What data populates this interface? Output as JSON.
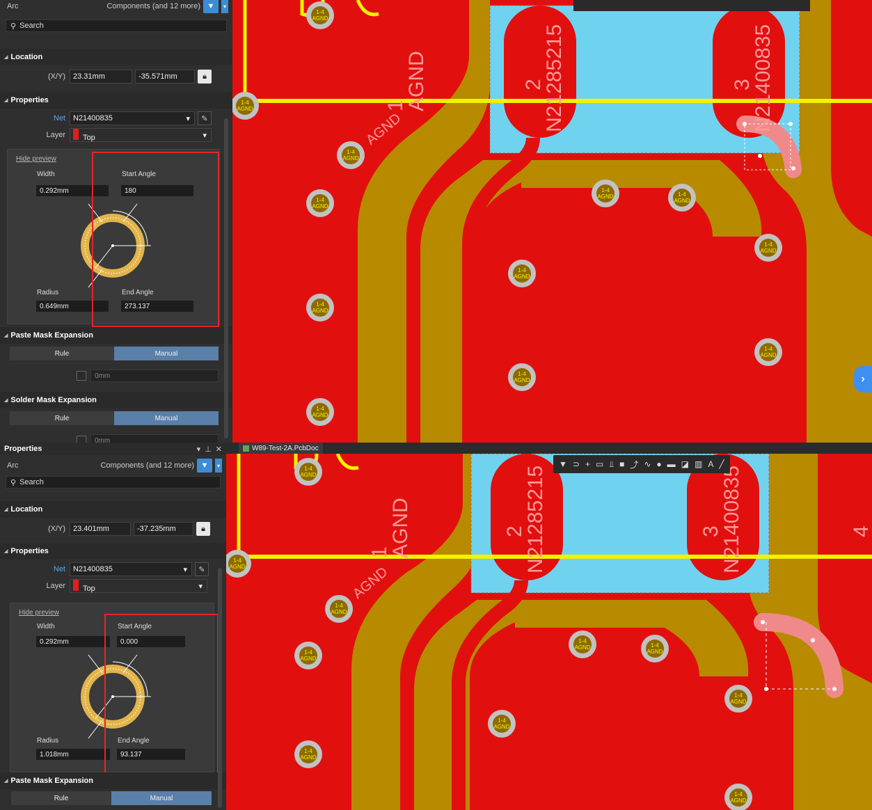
{
  "top": {
    "panel": {
      "object_type": "Arc",
      "filter_text": "Components (and 12 more)",
      "search_placeholder": "Search",
      "location_title": "Location",
      "xy_label": "(X/Y)",
      "x_value": "23.31mm",
      "y_value": "-35.571mm",
      "properties_title": "Properties",
      "net_label": "Net",
      "net_value": "N21400835",
      "layer_label": "Layer",
      "layer_value": "Top",
      "hide_preview": "Hide preview",
      "width_label": "Width",
      "width_value": "0.292mm",
      "start_angle_label": "Start Angle",
      "start_angle_value": "180",
      "radius_label": "Radius",
      "radius_value": "0.649mm",
      "end_angle_label": "End Angle",
      "end_angle_value": "273.137",
      "paste_mask_title": "Paste Mask Expansion",
      "rule_label": "Rule",
      "manual_label": "Manual",
      "mask_value": "0mm",
      "solder_mask_title": "Solder Mask Expansion",
      "solder_rule_label": "Rule",
      "solder_manual_label": "Manual",
      "solder_mask_value": "0mm"
    }
  },
  "bottom": {
    "panel": {
      "panel_title": "Properties",
      "object_type": "Arc",
      "filter_text": "Components (and 12 more)",
      "search_placeholder": "Search",
      "location_title": "Location",
      "xy_label": "(X/Y)",
      "x_value": "23.401mm",
      "y_value": "-37.235mm",
      "properties_title": "Properties",
      "net_label": "Net",
      "net_value": "N21400835",
      "layer_label": "Layer",
      "layer_value": "Top",
      "hide_preview": "Hide preview",
      "width_label": "Width",
      "width_value": "0.292mm",
      "start_angle_label": "Start Angle",
      "start_angle_value": "0.000",
      "radius_label": "Radius",
      "radius_value": "1.018mm",
      "end_angle_label": "End Angle",
      "end_angle_value": "93.137",
      "paste_mask_title": "Paste Mask Expansion",
      "rule_label": "Rule",
      "manual_label": "Manual"
    },
    "doc_tab": "W89-Test-2A.PcbDoc"
  },
  "pcb": {
    "agnd": "AGND",
    "via_line1": "1-4",
    "via_line2": "AGND",
    "pad1_num": "1",
    "pad1_net": "AGND",
    "pad2_num": "2",
    "pad2_net": "N21285215",
    "pad3_num": "3",
    "pad3_net": "N21400835",
    "pad4_num": "4"
  },
  "colors": {
    "copper": "#e20f0f",
    "clearance": "#b88a00",
    "pad_area": "#6fd3ef",
    "silkscreen": "#f2f200",
    "arc_highlight": "#f08a8a",
    "via": "#c2c2c2"
  }
}
